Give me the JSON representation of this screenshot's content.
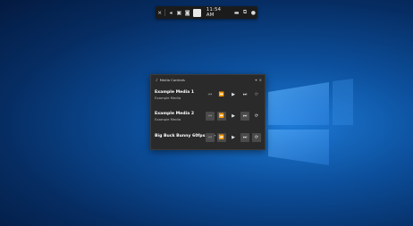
{
  "gamebar": {
    "time": "11:54 AM",
    "icons": [
      "close-icon",
      "audio-icon",
      "capture-icon",
      "performance-icon",
      "widget-icon",
      "settings-icon"
    ]
  },
  "media_controls": {
    "title": "Media Controls",
    "items": [
      {
        "title": "Example Media 1",
        "subtitle": "Example Media"
      },
      {
        "title": "Example Media 2",
        "subtitle": "Example Media"
      },
      {
        "title": "Big Buck Bunny 60fps 4K -",
        "subtitle": ""
      }
    ]
  },
  "colors": {
    "panel_bg": "#2a2a2a",
    "desktop_bg": "#0c4f9c",
    "gamebar_bg": "#1b1b1b"
  }
}
